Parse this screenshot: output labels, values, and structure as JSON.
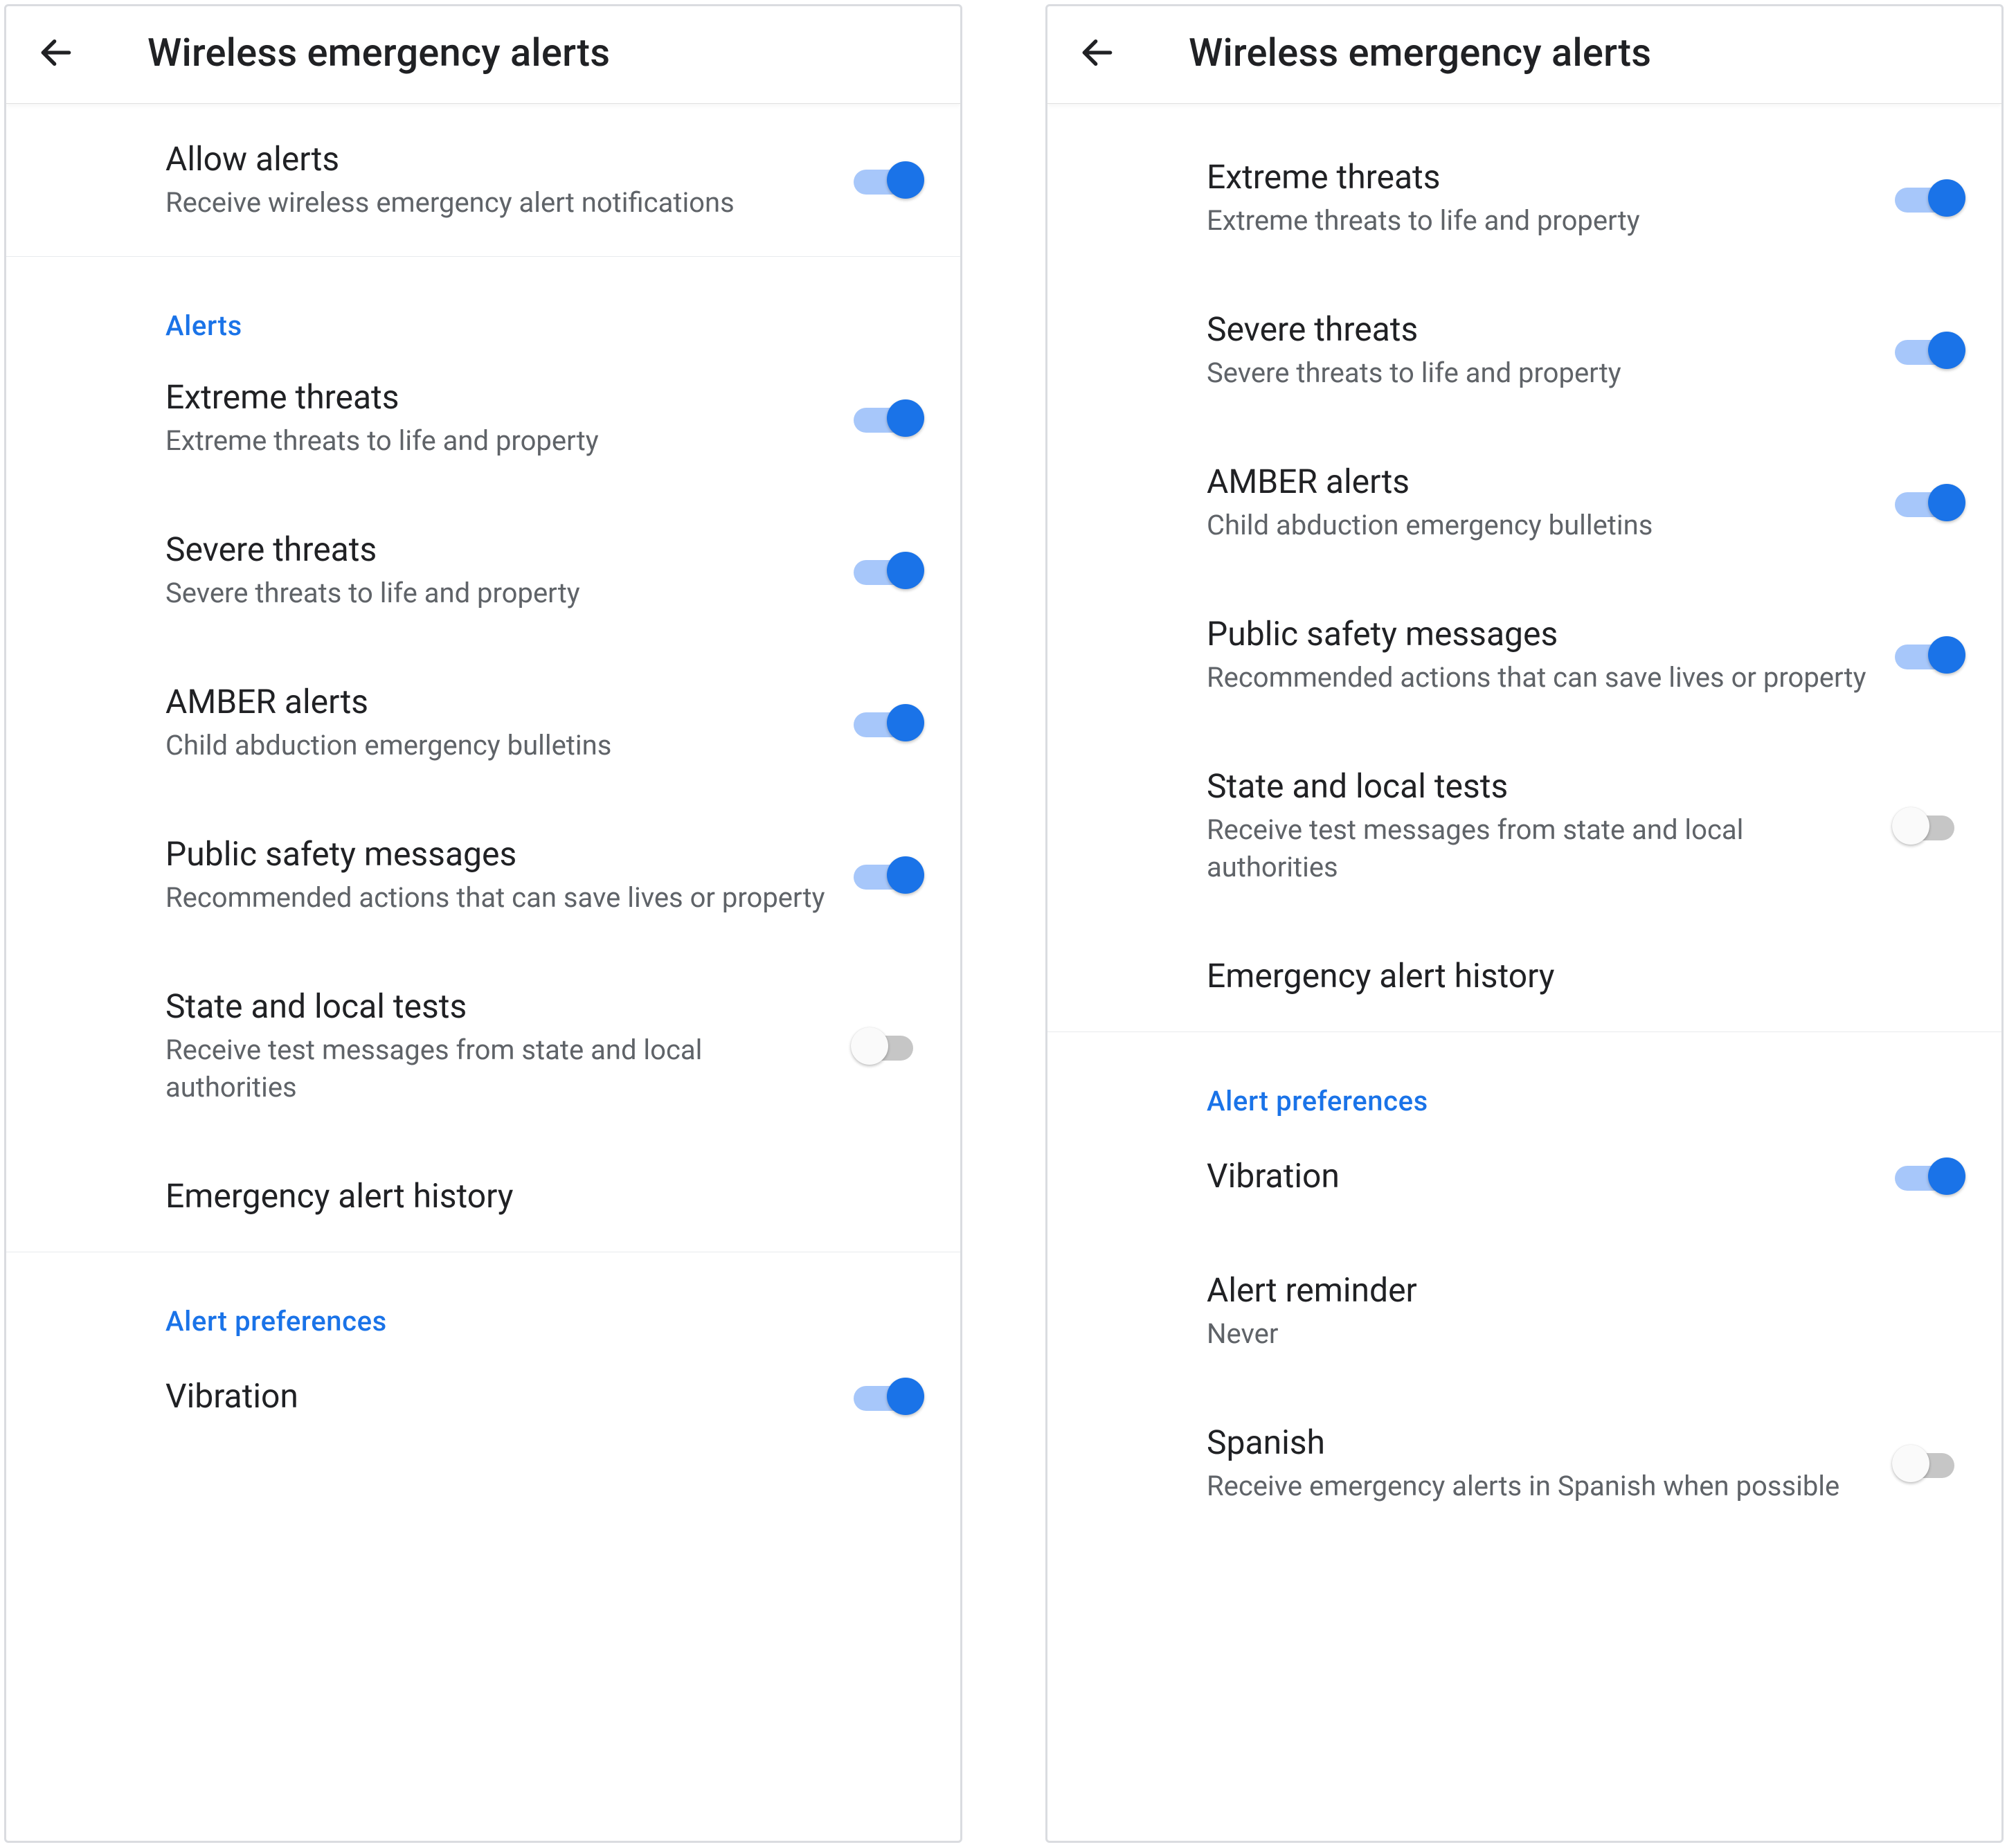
{
  "colors": {
    "accent": "#1a73e8",
    "text": "#202124",
    "subtext": "#5f6368",
    "divider": "#e8eaed"
  },
  "left": {
    "header": {
      "title": "Wireless emergency alerts"
    },
    "allow": {
      "title": "Allow alerts",
      "sub": "Receive wireless emergency alert notifications",
      "on": true
    },
    "section_alerts": {
      "header": "Alerts"
    },
    "items": [
      {
        "key": "extreme",
        "title": "Extreme threats",
        "sub": "Extreme threats to life and property",
        "on": true
      },
      {
        "key": "severe",
        "title": "Severe threats",
        "sub": "Severe threats to life and property",
        "on": true
      },
      {
        "key": "amber",
        "title": "AMBER alerts",
        "sub": "Child abduction emergency bulletins",
        "on": true
      },
      {
        "key": "public",
        "title": "Public safety messages",
        "sub": "Recommended actions that can save lives or property",
        "on": true
      },
      {
        "key": "statelocal",
        "title": "State and local tests",
        "sub": "Receive test messages from state and local authorities",
        "on": false
      }
    ],
    "history": {
      "title": "Emergency alert history"
    },
    "section_prefs": {
      "header": "Alert preferences"
    },
    "vibration": {
      "title": "Vibration",
      "on": true
    }
  },
  "right": {
    "header": {
      "title": "Wireless emergency alerts"
    },
    "items": [
      {
        "key": "extreme",
        "title": "Extreme threats",
        "sub": "Extreme threats to life and property",
        "on": true
      },
      {
        "key": "severe",
        "title": "Severe threats",
        "sub": "Severe threats to life and property",
        "on": true
      },
      {
        "key": "amber",
        "title": "AMBER alerts",
        "sub": "Child abduction emergency bulletins",
        "on": true
      },
      {
        "key": "public",
        "title": "Public safety messages",
        "sub": "Recommended actions that can save lives or property",
        "on": true
      },
      {
        "key": "statelocal",
        "title": "State and local tests",
        "sub": "Receive test messages from state and local authorities",
        "on": false
      }
    ],
    "history": {
      "title": "Emergency alert history"
    },
    "section_prefs": {
      "header": "Alert preferences"
    },
    "vibration": {
      "title": "Vibration",
      "on": true
    },
    "reminder": {
      "title": "Alert reminder",
      "sub": "Never"
    },
    "spanish": {
      "title": "Spanish",
      "sub": "Receive emergency alerts in Spanish when possible",
      "on": false
    }
  }
}
